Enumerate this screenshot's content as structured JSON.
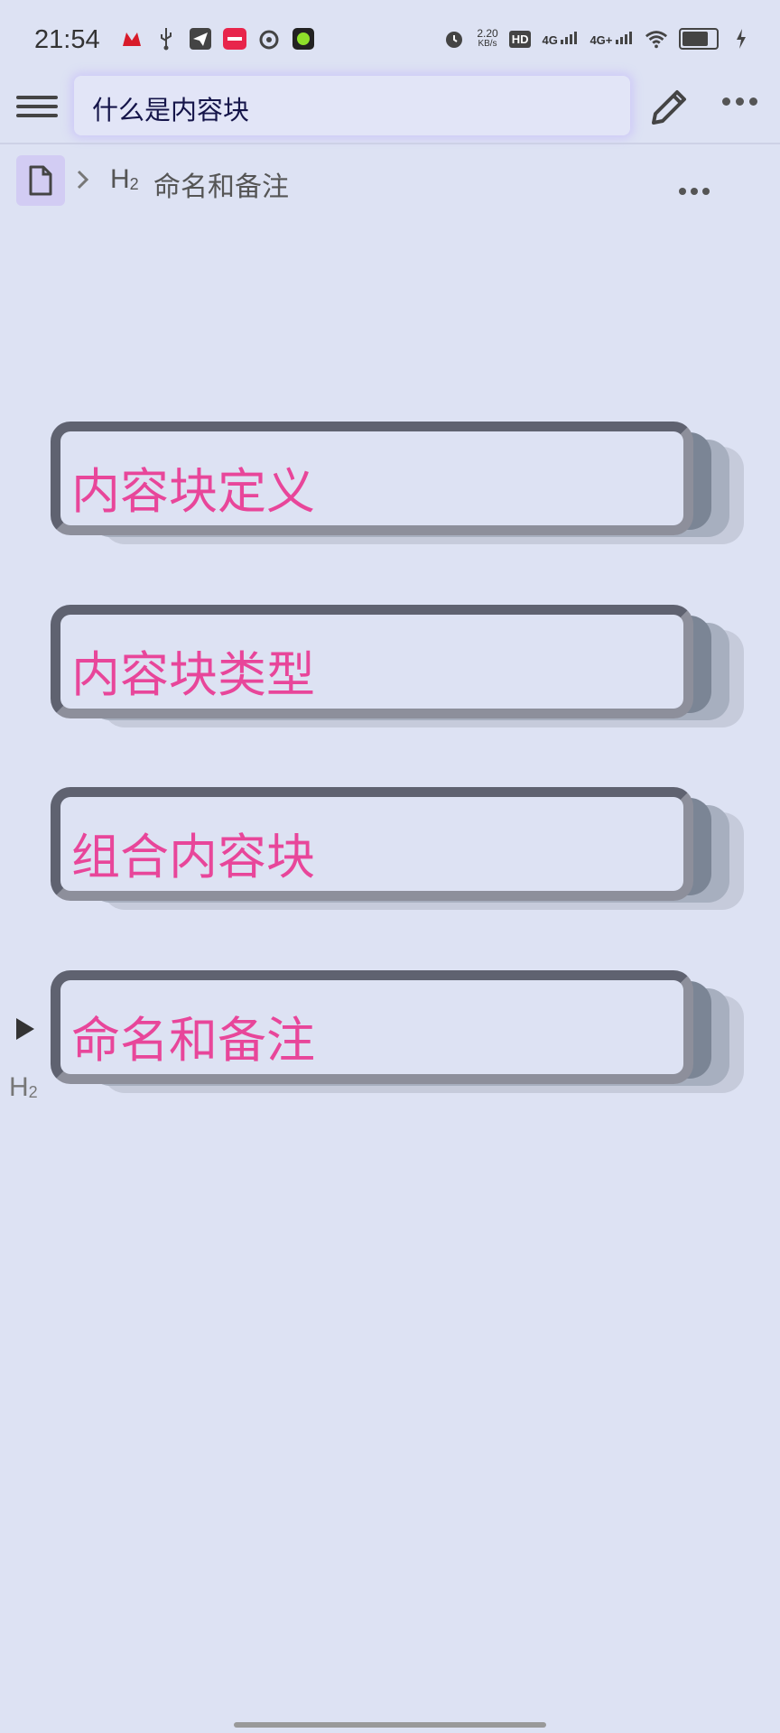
{
  "status_bar": {
    "time": "21:54",
    "net_speed": "2.20",
    "net_speed_unit": "KB/s",
    "hd_label": "HD",
    "sim1_label": "4G",
    "sim2_label": "4G+",
    "battery_percent": 80
  },
  "toolbar": {
    "title": "什么是内容块"
  },
  "breadcrumb": {
    "heading_level": "H",
    "heading_sub": "2",
    "label": "命名和备注"
  },
  "blocks": [
    {
      "text": "内容块定义"
    },
    {
      "text": "内容块类型"
    },
    {
      "text": "组合内容块"
    },
    {
      "text": "命名和备注"
    }
  ],
  "block_marker": {
    "level": "H",
    "sub": "2"
  }
}
